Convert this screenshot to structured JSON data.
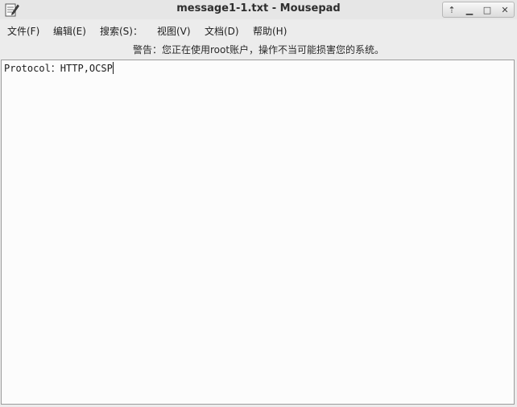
{
  "window": {
    "title": "message1-1.txt - Mousepad",
    "controls": [
      {
        "name": "shade-up",
        "symbol": "⇡"
      },
      {
        "name": "minimize",
        "symbol": "▁"
      },
      {
        "name": "maximize",
        "symbol": "□"
      },
      {
        "name": "close",
        "symbol": "✕"
      }
    ]
  },
  "menu": {
    "file": "文件(F)",
    "edit": "编辑(E)",
    "search": "搜索(S)：",
    "view": "视图(V)",
    "document": "文档(D)",
    "help": "帮助(H)"
  },
  "warning": "警告：您正在使用root账户，操作不当可能损害您的系统。",
  "editor": {
    "content": "Protocol：HTTP,OCSP"
  },
  "icons": {
    "app": "text-editor-icon",
    "shade_up": "arrow-up-icon",
    "minimize": "minimize-icon",
    "maximize": "maximize-icon",
    "close": "close-icon"
  }
}
